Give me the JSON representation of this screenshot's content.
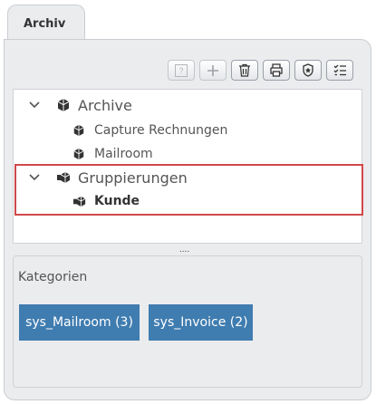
{
  "tab": {
    "label": "Archiv"
  },
  "toolbar": {
    "buttons": [
      {
        "icon": "help-icon",
        "label": "?",
        "disabled": true
      },
      {
        "icon": "plus-icon",
        "disabled": true
      },
      {
        "icon": "trash-icon"
      },
      {
        "icon": "print-icon"
      },
      {
        "icon": "badge-icon"
      },
      {
        "icon": "checklist-icon"
      }
    ]
  },
  "tree": {
    "archive": {
      "label": "Archive",
      "children": [
        "Capture Rechnungen",
        "Mailroom"
      ]
    },
    "groups": {
      "label": "Gruppierungen",
      "children": [
        "Kunde"
      ]
    }
  },
  "splitter": {
    "label": "...."
  },
  "categories": {
    "title": "Kategorien",
    "items": [
      "sys_Mailroom (3)",
      "sys_Invoice (2)"
    ]
  },
  "colors": {
    "accent": "#3f7cb0",
    "highlight": "#d1484b",
    "panel": "#ebecee"
  }
}
